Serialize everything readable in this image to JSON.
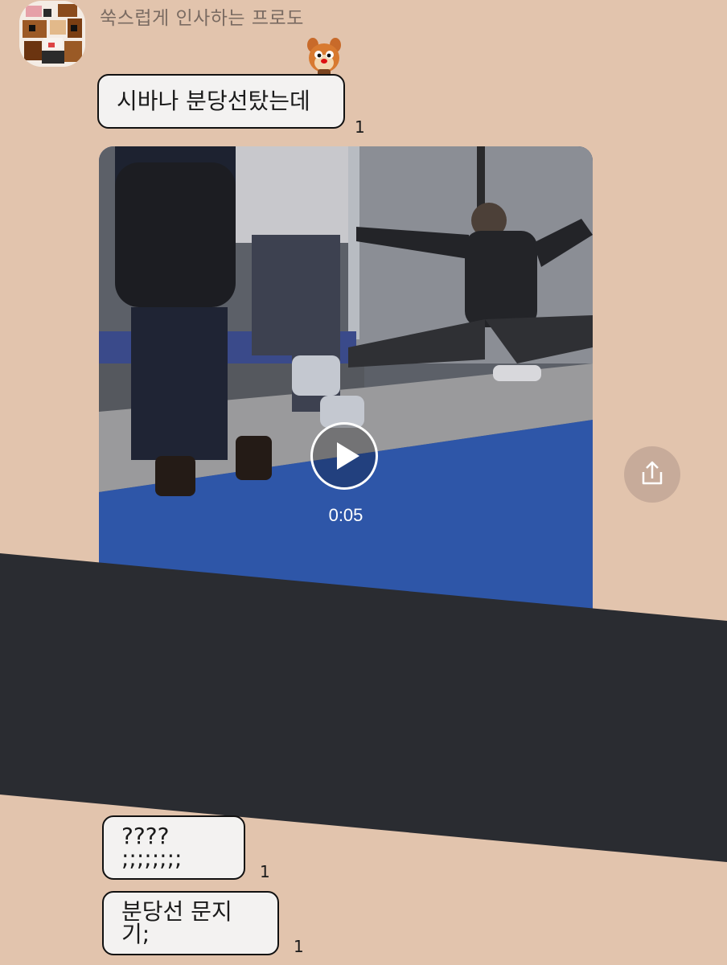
{
  "chat": {
    "sender_name": "쑥스럽게 인사하는 프로도",
    "messages": [
      {
        "text": "시바나 분당선탔는데",
        "unread": "1"
      },
      {
        "text": "???? ;;;;;;;;",
        "unread": "1"
      },
      {
        "text": "분당선 문지기;",
        "unread": "1"
      }
    ],
    "video": {
      "duration": "0:05"
    }
  },
  "icons": {
    "avatar": "pixel-character-avatar",
    "sticker": "chipmunk-sticker",
    "play": "play-icon",
    "share": "share-icon"
  },
  "colors": {
    "background": "#e2c4ad",
    "bubble": "#f3f2f1",
    "redaction": "#2a2c31",
    "share_button": "#c7ab9a"
  }
}
